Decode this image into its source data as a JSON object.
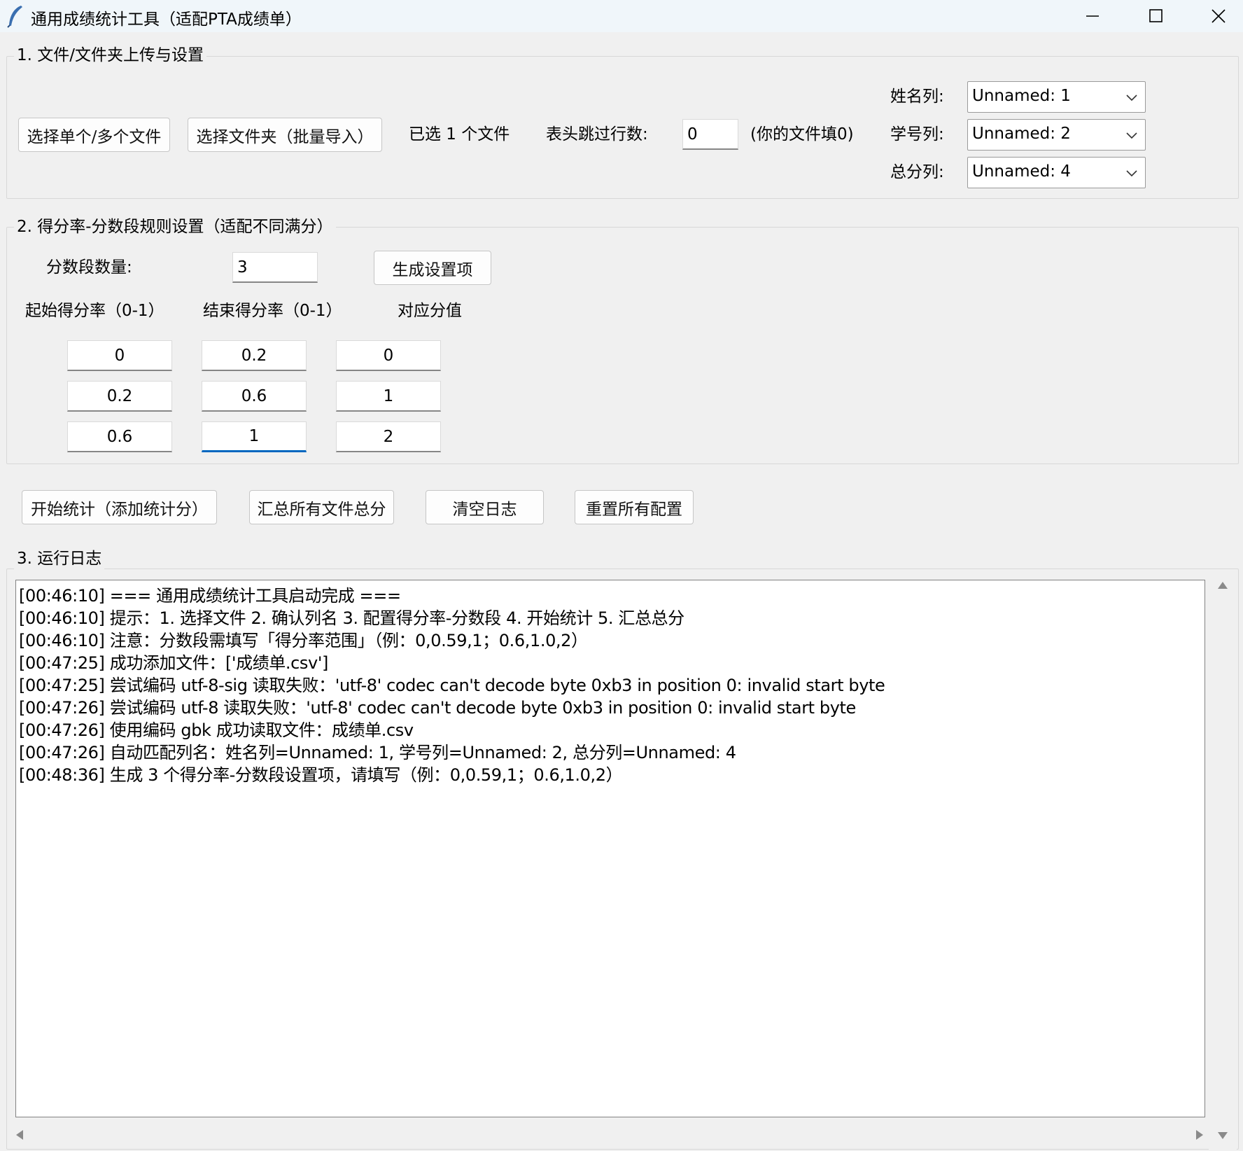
{
  "window": {
    "title": "通用成绩统计工具（适配PTA成绩单）",
    "min_icon": "minimize-icon",
    "max_icon": "maximize-icon",
    "close_icon": "close-icon"
  },
  "section1": {
    "title": "1. 文件/文件夹上传与设置",
    "select_files_button": "选择单个/多个文件",
    "select_folder_button": "选择文件夹（批量导入）",
    "selected_status": "已选 1 个文件",
    "skip_rows_label": "表头跳过行数:",
    "skip_rows_value": "0",
    "skip_rows_hint": "(你的文件填0)",
    "name_col_label": "姓名列:",
    "name_col_value": "Unnamed: 1",
    "id_col_label": "学号列:",
    "id_col_value": "Unnamed: 2",
    "total_col_label": "总分列:",
    "total_col_value": "Unnamed: 4"
  },
  "section2": {
    "title": "2. 得分率-分数段规则设置（适配不同满分）",
    "segment_count_label": "分数段数量:",
    "segment_count_value": "3",
    "generate_button": "生成设置项",
    "col_start": "起始得分率（0-1）",
    "col_end": "结束得分率（0-1）",
    "col_score": "对应分值",
    "rows": [
      {
        "start": "0",
        "end": "0.2",
        "score": "0"
      },
      {
        "start": "0.2",
        "end": "0.6",
        "score": "1"
      },
      {
        "start": "0.6",
        "end": "1",
        "score": "2"
      }
    ]
  },
  "actions": {
    "start_button": "开始统计（添加统计分）",
    "summary_button": "汇总所有文件总分",
    "clear_log_button": "清空日志",
    "reset_button": "重置所有配置"
  },
  "section3": {
    "title": "3. 运行日志",
    "lines": [
      "[00:46:10] === 通用成绩统计工具启动完成 ===",
      "[00:46:10] 提示：1. 选择文件 2. 确认列名 3. 配置得分率-分数段 4. 开始统计 5. 汇总总分",
      "[00:46:10] 注意：分数段需填写「得分率范围」（例：0,0.59,1；0.6,1.0,2）",
      "[00:47:25] 成功添加文件：['成绩单.csv']",
      "[00:47:25] 尝试编码 utf-8-sig 读取失败：'utf-8' codec can't decode byte 0xb3 in position 0: invalid start byte",
      "[00:47:26] 尝试编码 utf-8 读取失败：'utf-8' codec can't decode byte 0xb3 in position 0: invalid start byte",
      "[00:47:26] 使用编码 gbk 成功读取文件：成绩单.csv",
      "[00:47:26] 自动匹配列名：姓名列=Unnamed: 1, 学号列=Unnamed: 2, 总分列=Unnamed: 4",
      "[00:48:36] 生成 3 个得分率-分数段设置项，请填写（例：0,0.59,1；0.6,1.0,2）"
    ]
  }
}
